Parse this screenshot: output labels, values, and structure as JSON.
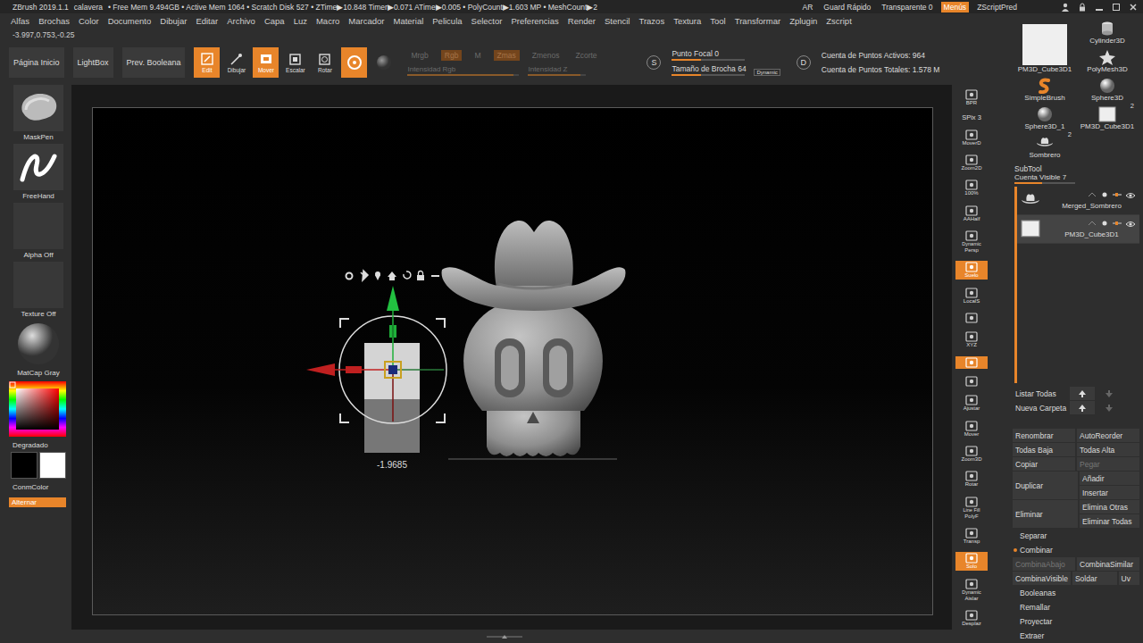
{
  "title_bar": {
    "app": "ZBrush 2019.1.1",
    "document": "calavera",
    "stats": "• Free Mem 9.494GB • Active Mem 1064 • Scratch Disk 527 • ZTime▶10.848 Timer▶0.071 ATime▶0.005 • PolyCount▶1.603 MP • MeshCount▶2",
    "controls": [
      {
        "label": "AR",
        "selected": false
      },
      {
        "label": "Guard Rápido",
        "selected": false
      },
      {
        "label": "Transparente 0",
        "selected": false
      },
      {
        "label": "Menús",
        "selected": true
      },
      {
        "label": "ZScriptPred",
        "selected": false
      }
    ]
  },
  "menu": [
    "Alfas",
    "Brochas",
    "Color",
    "Documento",
    "Dibujar",
    "Editar",
    "Archivo",
    "Capa",
    "Luz",
    "Macro",
    "Marcador",
    "Material",
    "Pelicula",
    "Selector",
    "Preferencias",
    "Render",
    "Stencil",
    "Trazos",
    "Textura",
    "Tool",
    "Transformar",
    "Zplugin",
    "Zscript"
  ],
  "coordinates": "-3.997,0.753,-0.25",
  "shelf": {
    "nav": [
      {
        "label": "Página Inicio"
      },
      {
        "label": "LightBox"
      },
      {
        "label": "Prev. Booleana"
      }
    ],
    "modes": [
      {
        "label": "Edit",
        "selected": true,
        "kind": "edit"
      },
      {
        "label": "Dibujar",
        "selected": false,
        "kind": "draw"
      },
      {
        "label": "Mover",
        "selected": true,
        "kind": "move"
      },
      {
        "label": "Escalar",
        "selected": false,
        "kind": "scale"
      },
      {
        "label": "Rotar",
        "selected": false,
        "kind": "rotate"
      }
    ],
    "gizmo_toggle": {
      "on": true
    },
    "channels": [
      {
        "label": "Mrgb",
        "on": false
      },
      {
        "label": "Rgb",
        "on": true
      },
      {
        "label": "M",
        "on": false
      },
      {
        "label": "Zmas",
        "on": true
      },
      {
        "label": "Zmenos",
        "on": false
      },
      {
        "label": "Zcorte",
        "on": false
      }
    ],
    "intensities": [
      {
        "label": "Intensidad Rgb",
        "level": 0.95
      },
      {
        "label": "Intensidad Z",
        "level": 0.9
      }
    ],
    "brush": {
      "badge": "S",
      "focal": {
        "label": "Punto Focal 0",
        "level": 0.4
      },
      "size": {
        "label": "Tamaño de Brocha 64",
        "level": 0.4
      },
      "dynamic": "Dynamic"
    },
    "points": {
      "badge": "D",
      "active": "Cuenta de Puntos Activos: 964",
      "total": "Cuenta de Puntos Totales: 1.578 M"
    }
  },
  "left_shelf": {
    "slots": [
      {
        "label": "MaskPen",
        "kind": "brush"
      },
      {
        "label": "FreeHand",
        "kind": "stroke"
      },
      {
        "label": "Alpha Off",
        "kind": "empty"
      },
      {
        "label": "Texture Off",
        "kind": "empty"
      },
      {
        "label": "MatCap Gray",
        "kind": "material"
      }
    ],
    "gradient": "Degradado",
    "main_color": "#000000",
    "secondary_color": "#ffffff",
    "switch": "ConmColor",
    "alternate": {
      "label": "Alternar",
      "on": true
    }
  },
  "canvas": {
    "gizmo_value": "-1.9685"
  },
  "right_shelf": [
    {
      "kind": "button",
      "label": "BPR",
      "on": false
    },
    {
      "kind": "text",
      "label": "SPix 3",
      "on": false
    },
    {
      "kind": "button",
      "label": "MoverD",
      "on": false
    },
    {
      "kind": "button",
      "label": "Zoom2D",
      "on": false
    },
    {
      "kind": "button",
      "label": "100%",
      "on": false
    },
    {
      "kind": "button",
      "label": "AAHalf",
      "on": false
    },
    {
      "kind": "button",
      "sublabel": "Dynamic",
      "label": "Persp",
      "on": false
    },
    {
      "kind": "button",
      "label": "Suelo",
      "on": true
    },
    {
      "kind": "button",
      "label": "LocalS",
      "on": false
    },
    {
      "kind": "icon",
      "on": false
    },
    {
      "kind": "button",
      "label": "XYZ",
      "on": false
    },
    {
      "kind": "icon",
      "on": true
    },
    {
      "kind": "icon",
      "on": false
    },
    {
      "kind": "button",
      "label": "Ajustar",
      "on": false
    },
    {
      "kind": "button",
      "label": "Mover",
      "on": false
    },
    {
      "kind": "button",
      "label": "Zoom3D",
      "on": false
    },
    {
      "kind": "button",
      "label": "Rotar",
      "on": false
    },
    {
      "kind": "button",
      "sublabel": "Line Fill",
      "label": "PolyF",
      "on": false
    },
    {
      "kind": "button",
      "label": "Transp",
      "on": false
    },
    {
      "kind": "button",
      "label": "Solo",
      "on": true
    },
    {
      "kind": "button",
      "sublabel": "Dynamic",
      "label": "Aislar",
      "on": false
    },
    {
      "kind": "button",
      "label": "Desplaz",
      "on": false
    }
  ],
  "right_panel": {
    "tools": [
      {
        "label": "PM3D_Cube3D1",
        "kind": "doc",
        "count": "",
        "selected": true
      },
      {
        "label": "Cylinder3D",
        "kind": "cylinder",
        "count": "",
        "selected": false
      },
      {
        "label": "PolyMesh3D",
        "kind": "star",
        "count": "",
        "selected": false
      },
      {
        "label": "SimpleBrush",
        "kind": "brush",
        "count": "",
        "selected": false
      },
      {
        "label": "Sphere3D",
        "kind": "sphere",
        "count": "",
        "selected": false
      },
      {
        "label": "Sphere3D_1",
        "kind": "sphere",
        "count": "",
        "selected": false
      },
      {
        "label": "PM3D_Cube3D1",
        "kind": "cube",
        "count": "2",
        "selected": false
      },
      {
        "label": "Sombrero",
        "kind": "hat",
        "count": "2",
        "selected": false
      }
    ],
    "subtool": {
      "title": "SubTool",
      "visible_count": {
        "label": "Cuenta Visible 7",
        "level": 0.45
      },
      "items": [
        {
          "name": "Merged_Sombrero",
          "kind": "hat",
          "selected": false,
          "visible": true
        },
        {
          "name": "PM3D_Cube3D1",
          "kind": "cube",
          "selected": true,
          "visible": true
        }
      ],
      "actions": [
        {
          "kind": "icons",
          "buttons": [
            {
              "label": "Listar Todas",
              "disabled": false
            }
          ]
        },
        {
          "kind": "icons",
          "buttons": [
            {
              "label": "Nueva Carpeta",
              "disabled": false
            }
          ]
        },
        {
          "kind": "gap"
        },
        {
          "kind": "pair",
          "buttons": [
            {
              "label": "Renombrar",
              "disabled": false
            },
            {
              "label": "AutoReorder",
              "disabled": false
            }
          ]
        },
        {
          "kind": "pair",
          "buttons": [
            {
              "label": "Todas Baja",
              "disabled": false
            },
            {
              "label": "Todas Alta",
              "disabled": false
            }
          ]
        },
        {
          "kind": "pair",
          "buttons": [
            {
              "label": "Copiar",
              "disabled": false
            },
            {
              "label": "Pegar",
              "disabled": true
            }
          ]
        },
        {
          "kind": "split",
          "buttons": [
            {
              "label": "Duplicar",
              "disabled": false
            },
            {
              "label": "Añadir",
              "disabled": false
            },
            {
              "label": "Insertar",
              "disabled": false
            }
          ]
        },
        {
          "kind": "split",
          "buttons": [
            {
              "label": "Eliminar",
              "disabled": false
            },
            {
              "label": "Elimina Otras",
              "disabled": false
            },
            {
              "label": "Eliminar Todas",
              "disabled": false
            }
          ]
        },
        {
          "kind": "header",
          "label": "Separar",
          "expanded": false
        },
        {
          "kind": "header",
          "label": "Combinar",
          "expanded": true
        },
        {
          "kind": "pair",
          "buttons": [
            {
              "label": "CombinaAbajo",
              "disabled": true
            },
            {
              "label": "CombinaSimilar",
              "disabled": false
            }
          ]
        },
        {
          "kind": "triple",
          "buttons": [
            {
              "label": "CombinaVisible",
              "disabled": false
            },
            {
              "label": "Soldar",
              "disabled": false
            },
            {
              "label": "Uv",
              "disabled": false
            }
          ]
        },
        {
          "kind": "header",
          "label": "Booleanas",
          "expanded": false
        },
        {
          "kind": "header",
          "label": "Remallar",
          "expanded": false
        },
        {
          "kind": "header",
          "label": "Proyectar",
          "expanded": false
        },
        {
          "kind": "header",
          "label": "Extraer",
          "expanded": false
        }
      ]
    }
  }
}
